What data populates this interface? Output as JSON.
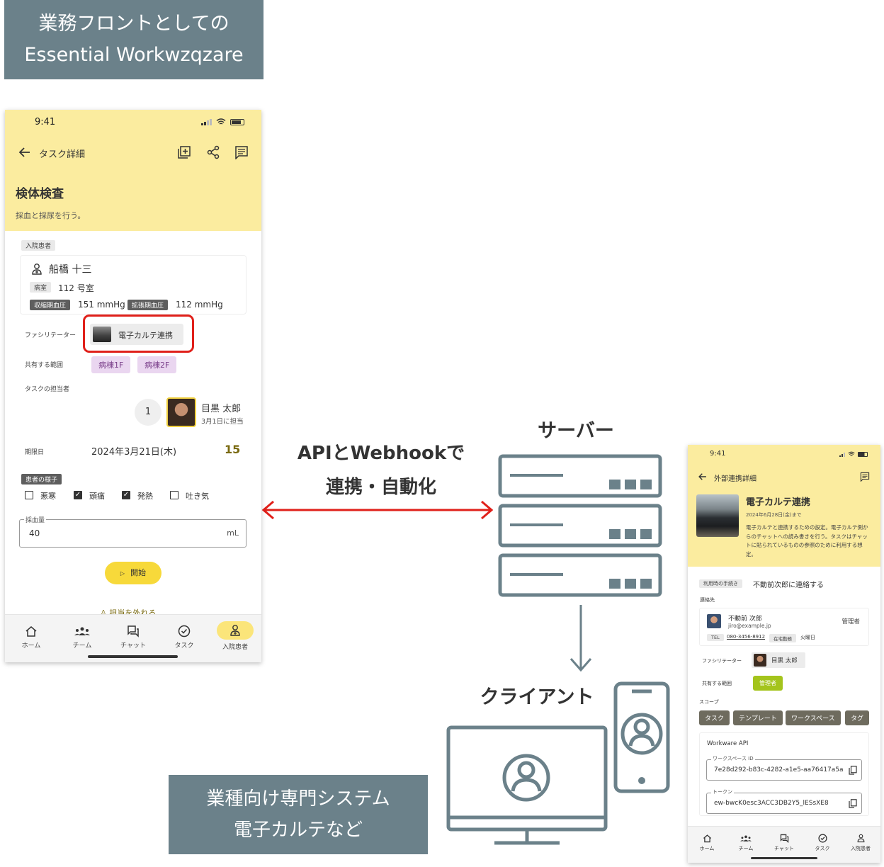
{
  "top_label": {
    "line1": "業務フロントとしての",
    "line2": "Essential Workwzqzare"
  },
  "bottom_label": {
    "line1": "業種向け専門システム",
    "line2": "電子カルテなど"
  },
  "arrow_text": {
    "line1": "APIとWebhookで",
    "line2": "連携・自動化"
  },
  "server_label": "サーバー",
  "client_label": "クライアント",
  "colors": {
    "accent_yellow": "#fbec9f",
    "arrow_red": "#e0201a",
    "slate": "#6b818a"
  },
  "phone1": {
    "time": "9:41",
    "header_title": "タスク詳細",
    "task_title": "検体検査",
    "task_desc": "採血と採尿を行う。",
    "patient_tag": "入院患者",
    "patient_name": "船橋 十三",
    "room_tag": "病室",
    "room_value": "112 号室",
    "systolic_tag": "収縮期血圧",
    "systolic_value": "151 mmHg",
    "diastolic_tag": "拡張期血圧",
    "diastolic_value": "112 mmHg",
    "facilitator_label": "ファシリテーター",
    "facilitator_name": "電子カルテ連携",
    "scope_label": "共有する範囲",
    "scope_chips": [
      "病棟1F",
      "病棟2F"
    ],
    "assignee_label": "タスクの担当者",
    "assignee_count": "1",
    "assignee_name": "目黒 太郎",
    "assignee_sub": "3月1日に担当",
    "due_label": "期限日",
    "due_date": "2024年3月21日(木)",
    "due_days": "15",
    "condition_tag": "患者の様子",
    "checks": [
      {
        "label": "悪寒",
        "checked": false
      },
      {
        "label": "頭痛",
        "checked": true
      },
      {
        "label": "発熱",
        "checked": true
      },
      {
        "label": "吐き気",
        "checked": false
      }
    ],
    "blood_label": "採血量",
    "blood_value": "40",
    "blood_unit": "mL",
    "start_button": "開始",
    "unassign_link": "担当を外れる",
    "nav": [
      "ホーム",
      "チーム",
      "チャット",
      "タスク",
      "入院患者"
    ]
  },
  "phone2": {
    "time": "9:41",
    "header_title": "外部連携詳細",
    "title": "電子カルテ連携",
    "deadline": "2024年6月28日(金)まで",
    "desc": "電子カルテと連携するための設定。電子カルテ側からのチャットへの読み書きを行う。タスクはチャットに貼られているものの参照のために利用する想定。",
    "procedure_tag": "利用時の手続き",
    "procedure_value": "不動前次郎に連絡する",
    "contact_tag": "連絡先",
    "contact_name": "不動前 次郎",
    "contact_email": "jiro@example.jp",
    "contact_role": "管理者",
    "tel_tag": "TEL",
    "tel_value": "080-3456-8912",
    "status_tag": "在宅勤務",
    "status_day": "火曜日",
    "facilitator_label": "ファシリテーター",
    "facilitator_name": "目黒 太郎",
    "scope_label": "共有する範囲",
    "scope_chip": "管理者",
    "scopes_label": "スコープ",
    "scopes": [
      "タスク",
      "テンプレート",
      "ワークスペース",
      "タグ"
    ],
    "api_title": "Workware API",
    "workspace_label": "ワークスペース ID",
    "workspace_value": "7e28d292-b83c-4282-a1e5-aa76417a5a",
    "token_label": "トークン",
    "token_value": "ew-bwcK0esc3ACC3DB2Y5_lESsXE8",
    "nav": [
      "ホーム",
      "チーム",
      "チャット",
      "タスク",
      "入院患者"
    ]
  }
}
